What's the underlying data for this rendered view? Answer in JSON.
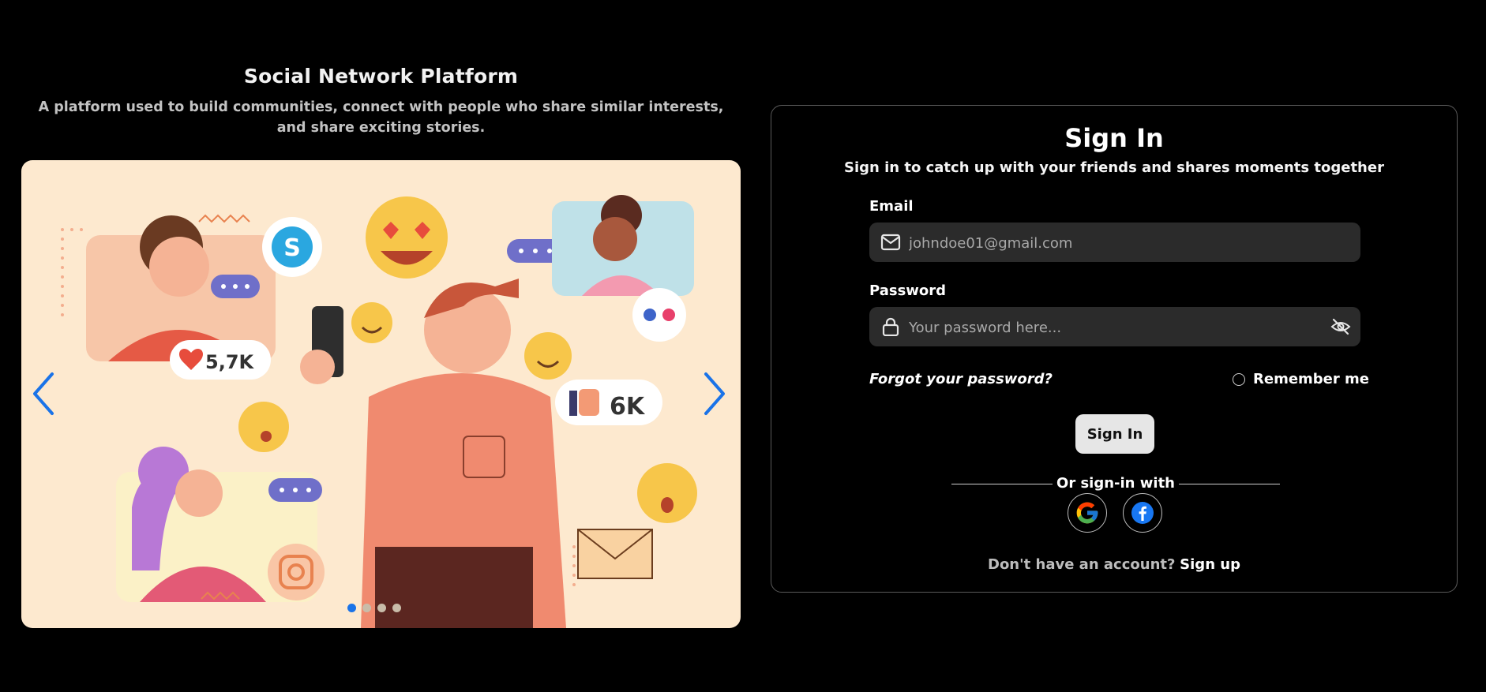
{
  "hero": {
    "title": "Social Network Platform",
    "subtitle": "A platform used to build communities, connect with people who share similar interests, and share exciting stories."
  },
  "carousel": {
    "badge_likes": "5,7K",
    "badge_thumbs": "6K",
    "slide_count": 4,
    "active_slide": 1
  },
  "signin": {
    "title": "Sign In",
    "subtitle": "Sign in to catch up with your friends and shares moments together",
    "email_label": "Email",
    "email_placeholder": "johndoe01@gmail.com",
    "password_label": "Password",
    "password_placeholder": "Your password here...",
    "forgot": "Forgot your password?",
    "remember": "Remember me",
    "button": "Sign In",
    "divider": "Or sign-in with",
    "no_account": "Don't have an account?",
    "signup": "Sign up"
  },
  "colors": {
    "accent": "#1a73e8",
    "background": "#000000",
    "input_bg": "#2b2b2b",
    "carousel_bg": "#fde9cf"
  },
  "icons": [
    "chevron-left-icon",
    "chevron-right-icon",
    "mail-icon",
    "lock-icon",
    "eye-off-icon",
    "google-icon",
    "facebook-icon"
  ]
}
